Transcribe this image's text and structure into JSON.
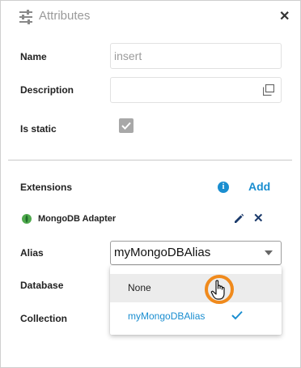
{
  "header": {
    "title": "Attributes",
    "icon": "sliders-icon",
    "close_icon": "close-icon"
  },
  "form": {
    "name_label": "Name",
    "name_placeholder": "insert",
    "description_label": "Description",
    "is_static_label": "Is static",
    "is_static_checked": true
  },
  "extensions": {
    "label": "Extensions",
    "info_icon": "info-icon",
    "add_label": "Add",
    "item": {
      "name": "MongoDB Adapter",
      "icon": "mongodb-leaf-icon"
    }
  },
  "alias": {
    "label": "Alias",
    "value": "myMongoDBAlias",
    "options": [
      {
        "label": "None",
        "hovered": true
      },
      {
        "label": "myMongoDBAlias",
        "selected": true
      }
    ]
  },
  "database": {
    "label": "Database"
  },
  "collection": {
    "label": "Collection"
  },
  "colors": {
    "accent": "#1a8ed0",
    "cursor_highlight": "#f08a1c",
    "mongo_green": "#4fa94d"
  }
}
